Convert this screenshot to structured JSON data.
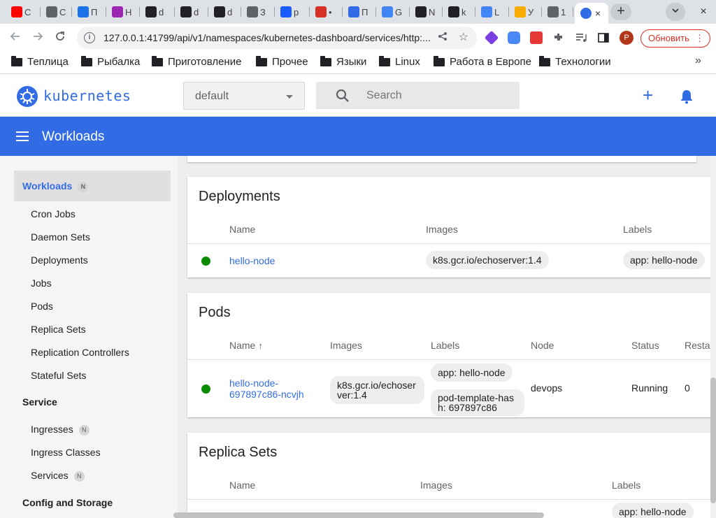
{
  "browser": {
    "tabs": [
      {
        "title": "C",
        "icon": "youtube-icon",
        "color": "#ff0000"
      },
      {
        "title": "С",
        "icon": "globe-icon",
        "color": "#5f6368"
      },
      {
        "title": "П",
        "icon": "mail-icon",
        "color": "#1a73e8"
      },
      {
        "title": "Н",
        "icon": "app-icon",
        "color": "#9c27b0"
      },
      {
        "title": "d",
        "icon": "github-icon",
        "color": "#202124"
      },
      {
        "title": "d",
        "icon": "github-icon",
        "color": "#202124"
      },
      {
        "title": "d",
        "icon": "github-icon",
        "color": "#202124"
      },
      {
        "title": "З",
        "icon": "globe-icon",
        "color": "#5f6368"
      },
      {
        "title": "p",
        "icon": "yc-icon",
        "color": "#1a5cff"
      },
      {
        "title": "•",
        "icon": "record-icon",
        "color": "#d93025"
      },
      {
        "title": "П",
        "icon": "kubernetes-icon",
        "color": "#326ce5"
      },
      {
        "title": "G",
        "icon": "translate-icon",
        "color": "#4285f4"
      },
      {
        "title": "N",
        "icon": "github-icon",
        "color": "#202124"
      },
      {
        "title": "k",
        "icon": "github-icon",
        "color": "#202124"
      },
      {
        "title": "L",
        "icon": "google-icon",
        "color": "#4285f4"
      },
      {
        "title": "У",
        "icon": "bulb-icon",
        "color": "#f9ab00"
      },
      {
        "title": "1",
        "icon": "globe-icon",
        "color": "#5f6368"
      }
    ],
    "active_tab_icon": "kubernetes-icon",
    "close_symbol": "×",
    "new_tab_symbol": "+",
    "url": "127.0.0.1:41799/api/v1/namespaces/kubernetes-dashboard/services/http:...",
    "profile_initial": "P",
    "update_label": "Обновить",
    "bookmarks": [
      "Теплица",
      "Рыбалка",
      "Приготовление",
      "Прочее",
      "Языки",
      "Linux",
      "Работа в Европе",
      "Технологии"
    ],
    "bookmarks_more": "»"
  },
  "header": {
    "brand": "kubernetes",
    "namespace": "default",
    "search_placeholder": "Search",
    "page_title": "Workloads"
  },
  "sidebar": {
    "active": {
      "label": "Workloads",
      "badge": "N"
    },
    "workload_items": [
      "Cron Jobs",
      "Daemon Sets",
      "Deployments",
      "Jobs",
      "Pods",
      "Replica Sets",
      "Replication Controllers",
      "Stateful Sets"
    ],
    "service_heading": "Service",
    "service_items": [
      {
        "label": "Ingresses",
        "badge": "N"
      },
      {
        "label": "Ingress Classes",
        "badge": ""
      },
      {
        "label": "Services",
        "badge": "N"
      }
    ],
    "config_heading": "Config and Storage"
  },
  "deployments": {
    "title": "Deployments",
    "columns": [
      "Name",
      "Images",
      "Labels"
    ],
    "rows": [
      {
        "name": "hello-node",
        "image": "k8s.gcr.io/echoserver:1.4",
        "label": "app: hello-node",
        "status_color": "#0a8c00"
      }
    ]
  },
  "pods": {
    "title": "Pods",
    "columns": [
      "Name",
      "Images",
      "Labels",
      "Node",
      "Status",
      "Resta"
    ],
    "sort_arrow": "↑",
    "rows": [
      {
        "name_line1": "hello-node-",
        "name_line2": "697897c86-ncvjh",
        "image_line1": "k8s.gcr.io/echoser",
        "image_line2": "ver:1.4",
        "label1": "app: hello-node",
        "label2_line1": "pod-template-has",
        "label2_line2": "h: 697897c86",
        "node": "devops",
        "status": "Running",
        "restarts": "0",
        "status_color": "#0a8c00"
      }
    ]
  },
  "replica_sets": {
    "title": "Replica Sets",
    "columns": [
      "Name",
      "Images",
      "Labels"
    ],
    "partial_label": "app: hello-node"
  }
}
